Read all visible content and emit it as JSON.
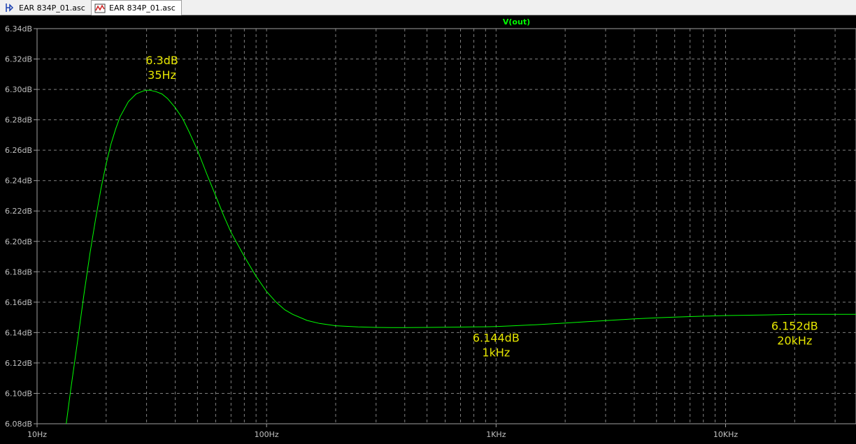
{
  "tabs": [
    {
      "label": "EAR 834P_01.asc",
      "icon": "schematic-icon",
      "active": false
    },
    {
      "label": "EAR 834P_01.asc",
      "icon": "waveform-icon",
      "active": true
    }
  ],
  "colors": {
    "background": "#000000",
    "trace": "#00ff00",
    "grid": "#808080",
    "axis_text": "#c0c0c0",
    "annotation": "#e6e600"
  },
  "chart_data": {
    "type": "line",
    "title": "V(out)",
    "xscale": "log",
    "xlim": [
      10,
      37000
    ],
    "ylim": [
      6.08,
      6.34
    ],
    "grid": true,
    "x_ticks": [
      {
        "value": 10,
        "label": "10Hz"
      },
      {
        "value": 100,
        "label": "100Hz"
      },
      {
        "value": 1000,
        "label": "1KHz"
      },
      {
        "value": 10000,
        "label": "10KHz"
      }
    ],
    "y_ticks": [
      {
        "value": 6.08,
        "label": "6.08dB"
      },
      {
        "value": 6.1,
        "label": "6.10dB"
      },
      {
        "value": 6.12,
        "label": "6.12dB"
      },
      {
        "value": 6.14,
        "label": "6.14dB"
      },
      {
        "value": 6.16,
        "label": "6.16dB"
      },
      {
        "value": 6.18,
        "label": "6.18dB"
      },
      {
        "value": 6.2,
        "label": "6.20dB"
      },
      {
        "value": 6.22,
        "label": "6.22dB"
      },
      {
        "value": 6.24,
        "label": "6.24dB"
      },
      {
        "value": 6.26,
        "label": "6.26dB"
      },
      {
        "value": 6.28,
        "label": "6.28dB"
      },
      {
        "value": 6.3,
        "label": "6.30dB"
      },
      {
        "value": 6.32,
        "label": "6.32dB"
      },
      {
        "value": 6.34,
        "label": "6.34dB"
      }
    ],
    "series": [
      {
        "name": "V(out)",
        "x": [
          13.4,
          14,
          15,
          16,
          17,
          18,
          19,
          20,
          21,
          22,
          23,
          25,
          27,
          29,
          30,
          31,
          32,
          33,
          35,
          37,
          40,
          43,
          46,
          50,
          55,
          60,
          65,
          70,
          80,
          90,
          100,
          110,
          120,
          130,
          150,
          170,
          200,
          250,
          300,
          350,
          400,
          500,
          600,
          700,
          800,
          900,
          1000,
          1200,
          1500,
          2000,
          2500,
          3000,
          4000,
          5000,
          6000,
          8000,
          10000,
          12000,
          15000,
          20000,
          25000,
          30000,
          37000
        ],
        "values": [
          6.08,
          6.102,
          6.134,
          6.165,
          6.192,
          6.215,
          6.235,
          6.251,
          6.264,
          6.274,
          6.282,
          6.292,
          6.297,
          6.299,
          6.2995,
          6.2995,
          6.299,
          6.2985,
          6.297,
          6.294,
          6.288,
          6.281,
          6.272,
          6.26,
          6.244,
          6.23,
          6.217,
          6.206,
          6.19,
          6.177,
          6.167,
          6.16,
          6.155,
          6.152,
          6.148,
          6.146,
          6.1445,
          6.1437,
          6.1434,
          6.1433,
          6.1433,
          6.1434,
          6.1435,
          6.1436,
          6.1437,
          6.1438,
          6.144,
          6.1445,
          6.1452,
          6.1463,
          6.1472,
          6.1479,
          6.149,
          6.1497,
          6.1502,
          6.1508,
          6.1512,
          6.1514,
          6.1516,
          6.152,
          6.152,
          6.152,
          6.152
        ]
      }
    ],
    "annotations": [
      {
        "line1": "6.3dB",
        "line2": "35Hz",
        "x": 35,
        "y": 6.3
      },
      {
        "line1": "6.144dB",
        "line2": "1kHz",
        "x": 1000,
        "y": 6.144
      },
      {
        "line1": "6.152dB",
        "line2": "20kHz",
        "x": 20000,
        "y": 6.152
      }
    ]
  }
}
